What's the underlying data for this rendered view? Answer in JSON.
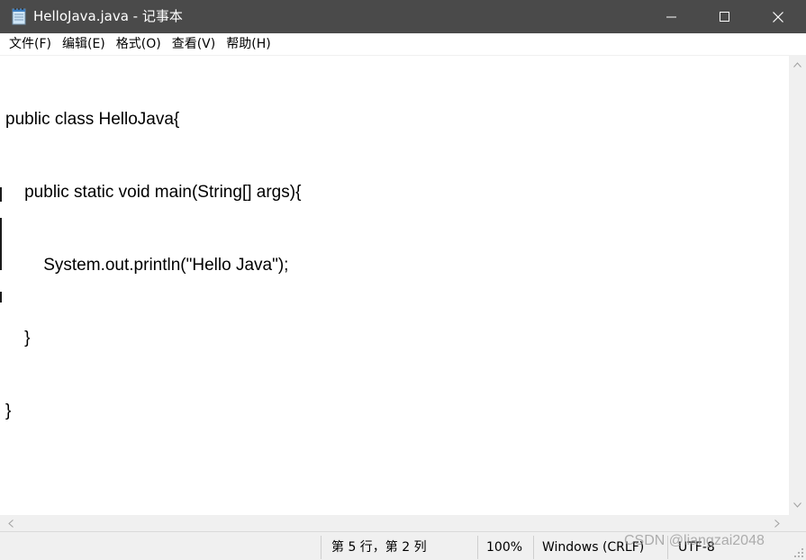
{
  "window": {
    "title": "HelloJava.java - 记事本",
    "icon": "notepad-icon",
    "controls": {
      "minimize": "minimize-icon",
      "maximize": "maximize-icon",
      "close": "close-icon"
    }
  },
  "menu": {
    "items": [
      {
        "label": "文件(F)"
      },
      {
        "label": "编辑(E)"
      },
      {
        "label": "格式(O)"
      },
      {
        "label": "查看(V)"
      },
      {
        "label": "帮助(H)"
      }
    ]
  },
  "editor": {
    "lines": [
      "public class HelloJava{",
      "    public static void main(String[] args){",
      "        System.out.println(\"Hello Java\");",
      "    }",
      "}"
    ]
  },
  "status": {
    "position": "第 5 行，第 2 列",
    "zoom": "100%",
    "line_ending": "Windows (CRLF)",
    "encoding": "UTF-8"
  },
  "watermark": "CSDN @liangzai2048",
  "colors": {
    "titlebar": "#4a4a4a",
    "title_text": "#ffffff",
    "statusbar": "#f0f0f0",
    "scrollbar": "#f0f0f0"
  }
}
